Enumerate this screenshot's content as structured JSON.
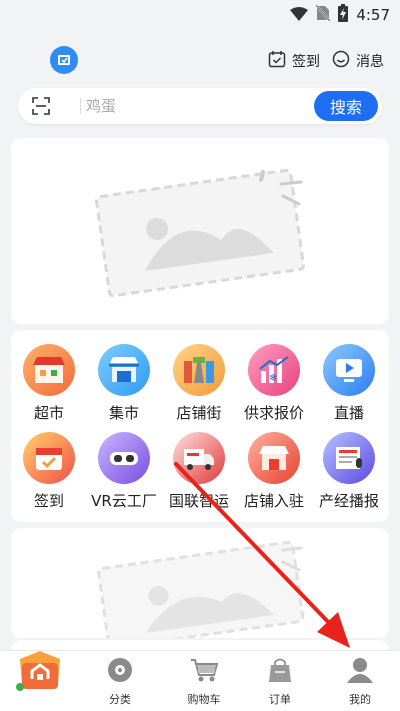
{
  "status_bar": {
    "time": "4:57"
  },
  "header": {
    "signin_label": "签到",
    "messages_label": "消息"
  },
  "search": {
    "placeholder": "鸡蛋",
    "button_label": "搜索"
  },
  "grid": {
    "items": [
      {
        "label": "超市",
        "icon": "supermarket-icon",
        "color": "#f26b3a"
      },
      {
        "label": "集市",
        "icon": "market-stall-icon",
        "color": "#2f9bf0"
      },
      {
        "label": "店铺街",
        "icon": "shop-street-icon",
        "color": "#f29b3a"
      },
      {
        "label": "供求报价",
        "icon": "price-chart-icon",
        "color": "#e8407a"
      },
      {
        "label": "直播",
        "icon": "live-stream-icon",
        "color": "#2a7df0"
      },
      {
        "label": "签到",
        "icon": "calendar-checkin-icon",
        "color": "#f0504a"
      },
      {
        "label": "VR云工厂",
        "icon": "vr-headset-icon",
        "color": "#7a4de0"
      },
      {
        "label": "国联智运",
        "icon": "logistics-truck-icon",
        "color": "#e03a3a"
      },
      {
        "label": "店铺入驻",
        "icon": "shop-join-icon",
        "color": "#e8402f"
      },
      {
        "label": "产经播报",
        "icon": "news-broadcast-icon",
        "color": "#5a4ae0"
      }
    ]
  },
  "bottom_nav": {
    "items": [
      {
        "label": "分类",
        "icon": "category-icon"
      },
      {
        "label": "购物车",
        "icon": "cart-icon"
      },
      {
        "label": "订单",
        "icon": "order-bag-icon"
      },
      {
        "label": "我的",
        "icon": "profile-icon"
      }
    ]
  },
  "colors": {
    "accent": "#1e6ef4",
    "annotation_arrow": "#e8231b",
    "background": "#f2f3f5"
  }
}
